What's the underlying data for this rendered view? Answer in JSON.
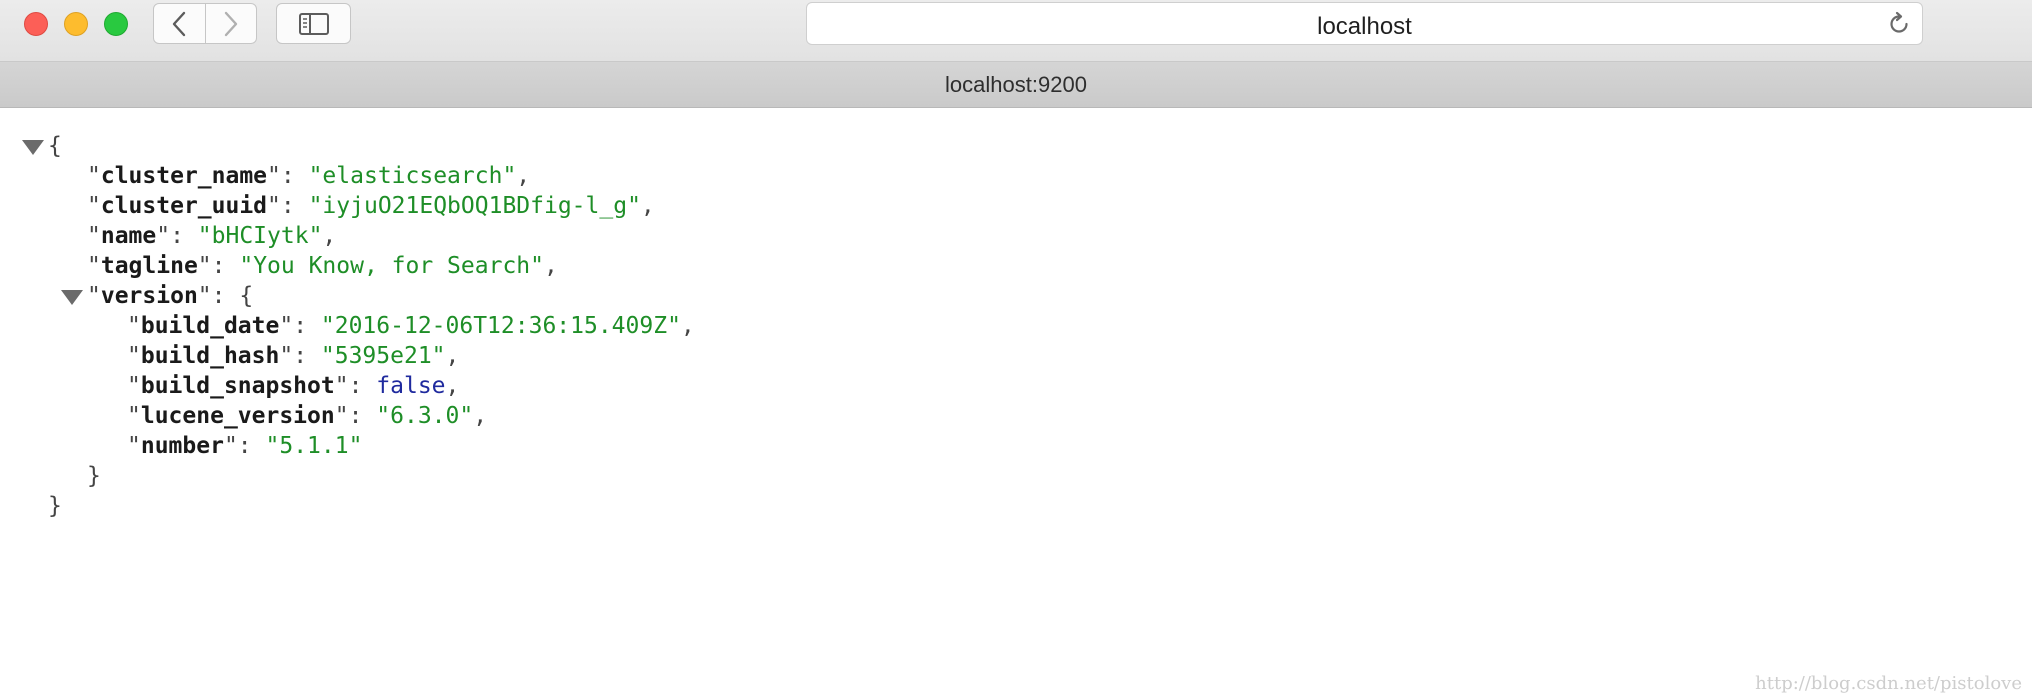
{
  "window": {
    "address": "localhost",
    "tab_title": "localhost:9200"
  },
  "json_view": {
    "open_brace": "{",
    "close_brace": "}",
    "fields": [
      {
        "key": "cluster_name",
        "value": "\"elasticsearch\"",
        "type": "string",
        "trailing": ","
      },
      {
        "key": "cluster_uuid",
        "value": "\"iyjuO21EQbOQ1BDfig-l_g\"",
        "type": "string",
        "trailing": ","
      },
      {
        "key": "name",
        "value": "\"bHCIytk\"",
        "type": "string",
        "trailing": ","
      },
      {
        "key": "tagline",
        "value": "\"You Know, for Search\"",
        "type": "string",
        "trailing": ","
      }
    ],
    "version": {
      "key": "version",
      "open_brace": "{",
      "close_brace": "}",
      "fields": [
        {
          "key": "build_date",
          "value": "\"2016-12-06T12:36:15.409Z\"",
          "type": "string",
          "trailing": ","
        },
        {
          "key": "build_hash",
          "value": "\"5395e21\"",
          "type": "string",
          "trailing": ","
        },
        {
          "key": "build_snapshot",
          "value": "false",
          "type": "boolean",
          "trailing": ","
        },
        {
          "key": "lucene_version",
          "value": "\"6.3.0\"",
          "type": "string",
          "trailing": ","
        },
        {
          "key": "number",
          "value": "\"5.1.1\"",
          "type": "string",
          "trailing": ""
        }
      ]
    }
  },
  "watermark": "http://blog.csdn.net/pistolove",
  "colors": {
    "string": "#1e8e27",
    "boolean": "#1f2a9e",
    "close": "#fc5f57",
    "minimize": "#fdbc2e",
    "maximize": "#29c940"
  },
  "icons": [
    "back-chevron-icon",
    "forward-chevron-icon",
    "sidebar-icon",
    "reload-icon",
    "collapse-triangle-icon"
  ]
}
